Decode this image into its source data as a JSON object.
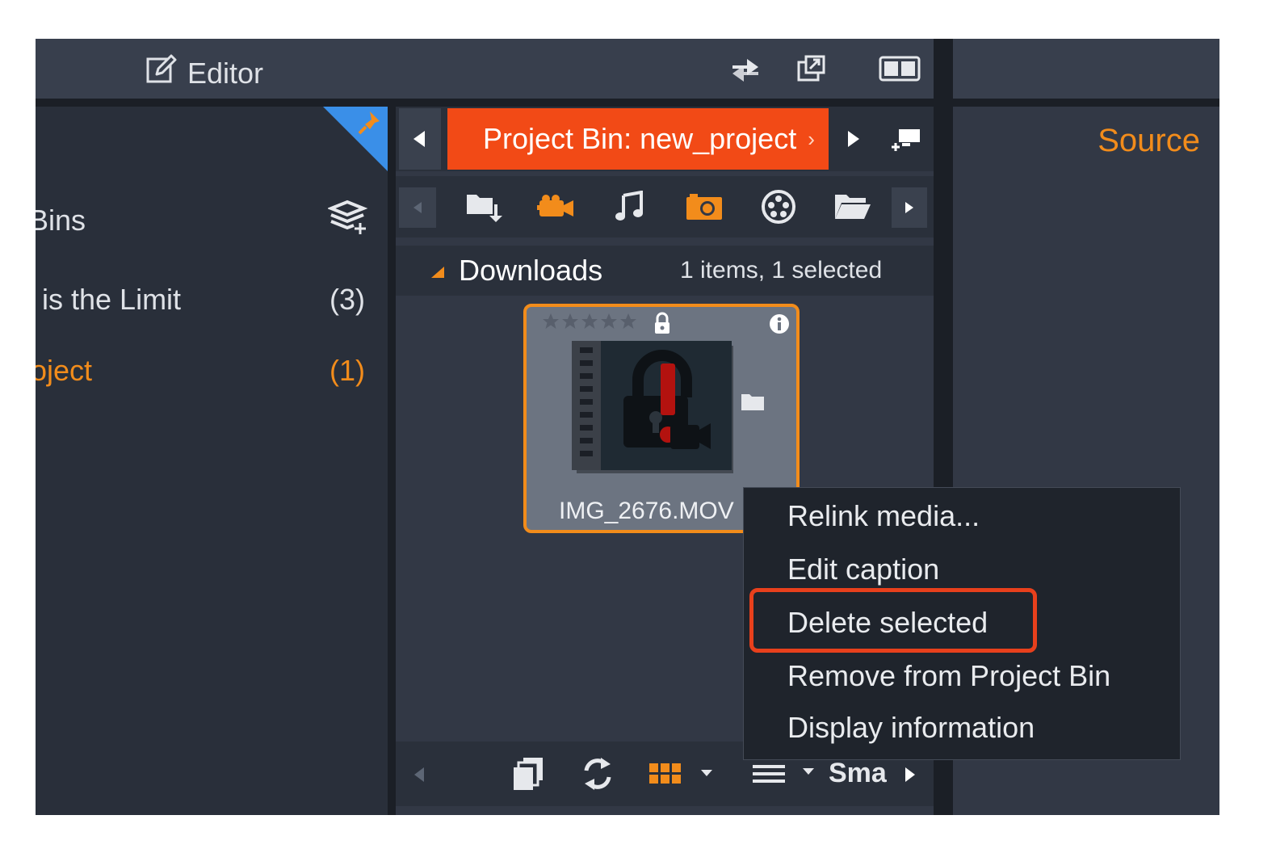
{
  "topbar": {
    "editor_label": "Editor",
    "icons": [
      "edit-icon",
      "swap-arrows-icon",
      "popout-icon",
      "layout-toggle-icon"
    ]
  },
  "left_panel": {
    "rows": [
      {
        "label": "Bins",
        "count": ""
      },
      {
        "label": "is the Limit",
        "count": "(3)"
      },
      {
        "label": "oject",
        "count": "(1)"
      }
    ],
    "accent_color": "#f28c1b"
  },
  "bin_tab": {
    "title": "Project Bin: new_project",
    "overflow_glyph": "›"
  },
  "media_icons": [
    "import-icon",
    "video-icon",
    "music-icon",
    "photo-icon",
    "disc-icon",
    "folder-icon"
  ],
  "downloads": {
    "title": "Downloads",
    "info": "1 items, 1 selected"
  },
  "clip": {
    "name": "IMG_2676.MOV",
    "rating": 0,
    "rating_max": 5
  },
  "bottom_bar": {
    "view_label": "Sma"
  },
  "right_panel": {
    "title": "Source"
  },
  "context_menu": {
    "items": [
      "Relink media...",
      "Edit caption",
      "Delete selected",
      "Remove from Project Bin",
      "Display information"
    ],
    "highlighted": "Delete selected"
  },
  "colors": {
    "orange": "#f28c1b",
    "tab_orange": "#f24a16",
    "highlight_red": "#e8401c",
    "pin_blue": "#3a8fe8"
  }
}
